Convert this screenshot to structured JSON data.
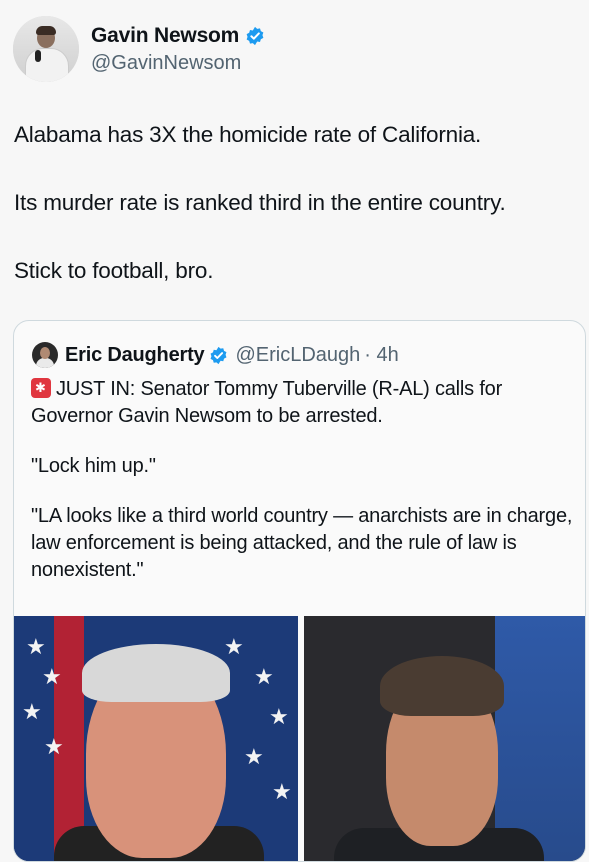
{
  "author": {
    "display_name": "Gavin Newsom",
    "handle": "@GavinNewsom",
    "verified_color": "#1d9bf0"
  },
  "tweet": {
    "lines": [
      "Alabama has 3X the homicide rate of California.",
      "Its murder rate is ranked third in the entire country.",
      "Stick to football, bro."
    ]
  },
  "quoted": {
    "display_name": "Eric Daugherty",
    "handle": "@EricLDaugh",
    "time": "· 4h",
    "siren_icon": "rotating-light-icon",
    "paragraphs": [
      "JUST IN: Senator Tommy Tuberville (R-AL) calls for Governor Gavin Newsom to be arrested.",
      "\"Lock him up.\"",
      "\"LA looks like a third world country — anarchists are in charge, law enforcement is being attacked, and the rule of law is nonexistent.\""
    ]
  }
}
